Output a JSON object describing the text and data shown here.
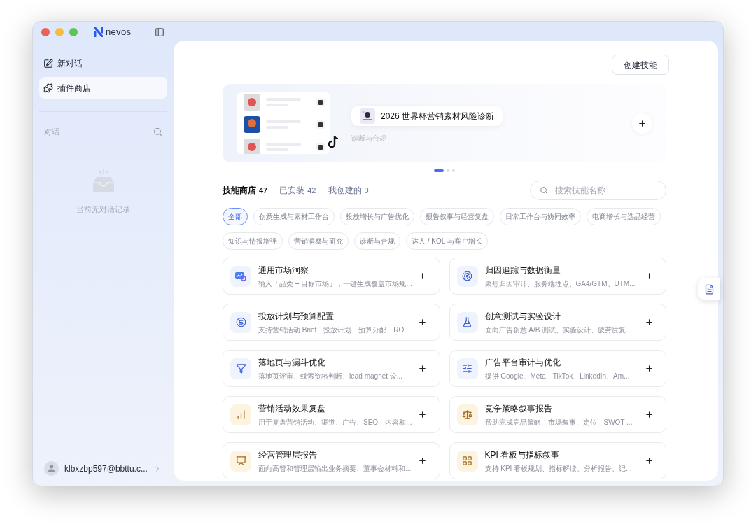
{
  "app": {
    "logo": "nevos"
  },
  "sidebar": {
    "items": [
      {
        "label": "新对话",
        "kind": "new",
        "selected": false
      },
      {
        "label": "插件商店",
        "kind": "plugins",
        "selected": true
      }
    ],
    "section_label": "对话",
    "empty_text": "当前无对话记录",
    "user": "klbxzbp597@bbttu.c..."
  },
  "create_button": "创建技能",
  "banner": {
    "title": "2026 世界杯营销素材风险诊断",
    "category": "诊断与合规",
    "dots": [
      {
        "selected": true
      },
      {
        "selected": false
      },
      {
        "selected": false
      }
    ]
  },
  "tabs": [
    {
      "label": "技能商店",
      "count": "47",
      "selected": true
    },
    {
      "label": "已安装",
      "count": "42",
      "selected": false
    },
    {
      "label": "我创建的",
      "count": "0",
      "selected": false
    }
  ],
  "search": {
    "placeholder": "搜索技能名称"
  },
  "chips": [
    {
      "label": "全部",
      "selected": true
    },
    {
      "label": "创意生成与素材工作台",
      "selected": false
    },
    {
      "label": "投放增长与广告优化",
      "selected": false
    },
    {
      "label": "报告叙事与经营复盘",
      "selected": false
    },
    {
      "label": "日常工作台与协同效率",
      "selected": false
    },
    {
      "label": "电商增长与选品经营",
      "selected": false
    },
    {
      "label": "知识与情报增强",
      "selected": false
    },
    {
      "label": "营销洞察与研究",
      "selected": false
    },
    {
      "label": "诊断与合规",
      "selected": false
    },
    {
      "label": "达人 / KOL 与客户增长",
      "selected": false
    }
  ],
  "skills": [
    {
      "title": "通用市场洞察",
      "description": "输入「品类 + 目标市场」，一键生成覆盖市场规...",
      "color": "#eef3fe"
    },
    {
      "title": "归因追踪与数据衡量",
      "description": "聚焦归因审计、服务端埋点、GA4/GTM、UTM...",
      "color": "#eef3fe"
    },
    {
      "title": "投放计划与预算配置",
      "description": "支持营销活动 Brief、投放计划、预算分配、RO...",
      "color": "#eef3fe"
    },
    {
      "title": "创意测试与实验设计",
      "description": "面向广告创意 A/B 测试、实验设计、疲劳度复...",
      "color": "#eef3fe"
    },
    {
      "title": "落地页与漏斗优化",
      "description": "落地页评审、线索资格判断、lead magnet 设...",
      "color": "#eef3fe"
    },
    {
      "title": "广告平台审计与优化",
      "description": "提供 Google、Meta、TikTok、LinkedIn、Am...",
      "color": "#eef3fe"
    },
    {
      "title": "营销活动效果复盘",
      "description": "用于复盘营销活动、渠道、广告、SEO、内容和...",
      "color": "#fdf3e1"
    },
    {
      "title": "竞争策略叙事报告",
      "description": "帮助完成竞品策略、市场叙事、定位、SWOT ...",
      "color": "#fdf3e1"
    },
    {
      "title": "经营管理层报告",
      "description": "面向高管和管理层输出业务摘要、董事会材料和...",
      "color": "#fdf3e1"
    },
    {
      "title": "KPI 看板与指标叙事",
      "description": "支持 KPI 看板规划、指标解读、分析报告、记...",
      "color": "#fdf3e1"
    }
  ]
}
